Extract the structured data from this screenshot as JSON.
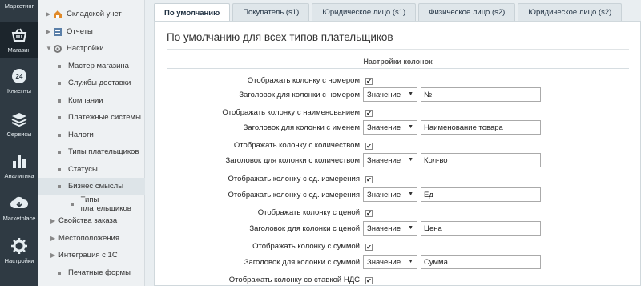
{
  "rail": {
    "top_label": "Маркетинг",
    "items": [
      {
        "label": "Магазин",
        "icon": "basket-icon",
        "active": true
      },
      {
        "label": "Клиенты",
        "icon": "clients-icon",
        "active": false
      },
      {
        "label": "Сервисы",
        "icon": "layers-icon",
        "active": false
      },
      {
        "label": "Аналитика",
        "icon": "bar-chart-icon",
        "active": false
      },
      {
        "label": "Marketplace",
        "icon": "cloud-download-icon",
        "active": false
      },
      {
        "label": "Настройки",
        "icon": "gear-icon",
        "active": false
      }
    ]
  },
  "tree": {
    "items": [
      {
        "label": "Складской учет",
        "kind": "folder"
      },
      {
        "label": "Отчеты",
        "kind": "folder"
      },
      {
        "label": "Настройки",
        "kind": "folder"
      },
      {
        "label": "Мастер магазина",
        "kind": "leaf"
      },
      {
        "label": "Службы доставки",
        "kind": "leaf"
      },
      {
        "label": "Компании",
        "kind": "leaf"
      },
      {
        "label": "Платежные системы",
        "kind": "leaf"
      },
      {
        "label": "Налоги",
        "kind": "leaf"
      },
      {
        "label": "Типы плательщиков",
        "kind": "leaf"
      },
      {
        "label": "Статусы",
        "kind": "leaf"
      },
      {
        "label": "Бизнес смыслы",
        "kind": "leaf",
        "selected": true
      },
      {
        "label": "Типы плательщиков",
        "kind": "subleaf"
      },
      {
        "label": "Свойства заказа",
        "kind": "leaf"
      },
      {
        "label": "Местоположения",
        "kind": "leaf"
      },
      {
        "label": "Интеграция с 1С",
        "kind": "leaf"
      },
      {
        "label": "Печатные формы",
        "kind": "leaf"
      }
    ]
  },
  "tabs": [
    {
      "label": "По умолчанию",
      "active": true
    },
    {
      "label": "Покупатель (s1)",
      "active": false
    },
    {
      "label": "Юридическое лицо (s1)",
      "active": false
    },
    {
      "label": "Физическое лицо (s2)",
      "active": false
    },
    {
      "label": "Юридическое лицо (s2)",
      "active": false
    }
  ],
  "panel": {
    "title": "По умолчанию для всех типов плательщиков",
    "section": "Настройки колонок"
  },
  "rows": [
    {
      "type": "checkbox",
      "label": "Отображать колонку с номером",
      "checked": true
    },
    {
      "type": "field",
      "label": "Заголовок для колонки с номером",
      "select": "Значение",
      "value": "№"
    },
    {
      "type": "checkbox",
      "label": "Отображать колонку с наименованием",
      "checked": true
    },
    {
      "type": "field",
      "label": "Заголовок для колонки с именем",
      "select": "Значение",
      "value": "Наименование товара"
    },
    {
      "type": "checkbox",
      "label": "Отображать колонку с количеством",
      "checked": true
    },
    {
      "type": "field",
      "label": "Заголовок для колонки с количеством",
      "select": "Значение",
      "value": "Кол-во"
    },
    {
      "type": "checkbox",
      "label": "Отображать колонку с ед. измерения",
      "checked": true
    },
    {
      "type": "field",
      "label": "Отображать колонку с ед. измерения",
      "select": "Значение",
      "value": "Ед"
    },
    {
      "type": "checkbox",
      "label": "Отображать колонку с ценой",
      "checked": true
    },
    {
      "type": "field",
      "label": "Заголовок для колонки с ценой",
      "select": "Значение",
      "value": "Цена"
    },
    {
      "type": "checkbox",
      "label": "Отображать колонку с суммой",
      "checked": true
    },
    {
      "type": "field",
      "label": "Заголовок для колонки с суммой",
      "select": "Значение",
      "value": "Сумма"
    },
    {
      "type": "checkbox",
      "label": "Отображать колонку со ставкой НДС",
      "checked": true
    }
  ]
}
